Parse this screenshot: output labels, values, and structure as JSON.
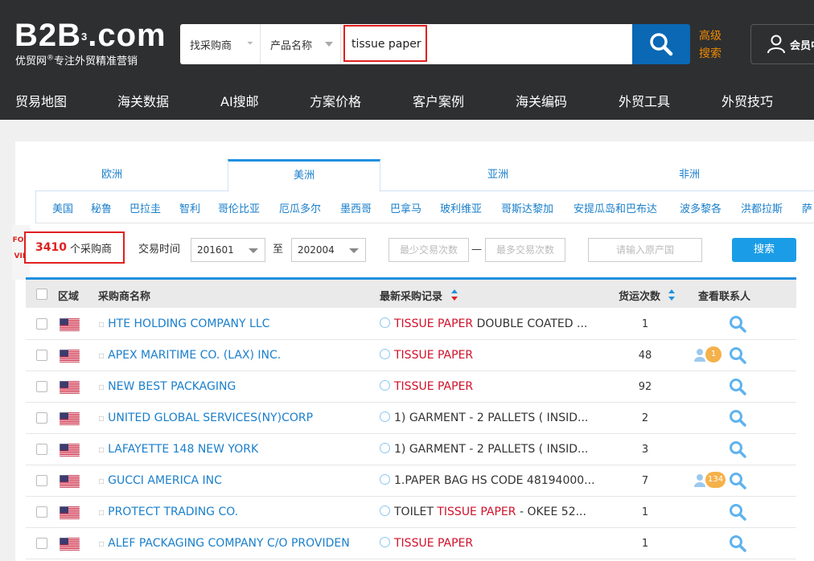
{
  "header": {
    "logo": "B2B",
    "logo_sup": "3",
    "logo_suffix": ".com",
    "tagline": "优贸网",
    "tagline_reg": "®",
    "tagline_rest": "专注外贸精准营销",
    "search": {
      "type_select": "找采购商",
      "field_select": "产品名称",
      "query": "tissue paper"
    },
    "advanced_line1": "高级",
    "advanced_line2": "搜索",
    "member_label": "会员中"
  },
  "nav": [
    "贸易地图",
    "海关数据",
    "AI搜邮",
    "方案价格",
    "客户案例",
    "海关编码",
    "外贸工具",
    "外贸技巧"
  ],
  "region_tabs": [
    "欧洲",
    "美洲",
    "亚洲",
    "非洲"
  ],
  "active_region": "美洲",
  "countries": [
    "美国",
    "秘鲁",
    "巴拉圭",
    "智利",
    "哥伦比亚",
    "厄瓜多尔",
    "墨西哥",
    "巴拿马",
    "玻利维亚",
    "哥斯达黎加",
    "安提瓜岛和巴布达",
    "波多黎各",
    "洪都拉斯",
    "萨"
  ],
  "filters": {
    "vip_line1": "FOR",
    "vip_line2": "VIP",
    "count": "3410",
    "count_unit": "个采购商",
    "time_label": "交易时间",
    "from": "201601",
    "to_label": "至",
    "to": "202004",
    "min_placeholder": "最少交易次数",
    "dash": "—",
    "max_placeholder": "最多交易次数",
    "origin_placeholder": "请输入原产国",
    "search_button": "搜索"
  },
  "table": {
    "columns": [
      "区域",
      "采购商名称",
      "最新采购记录",
      "货运次数",
      "查看联系人"
    ],
    "rows": [
      {
        "name": "HTE HOLDING COMPANY LLC",
        "rec_pre": "",
        "rec_hl": "TISSUE PAPER",
        "rec_post": " DOUBLE COATED ...",
        "shipments": "1",
        "contacts": ""
      },
      {
        "name": "APEX MARITIME CO. (LAX) INC.",
        "rec_pre": "",
        "rec_hl": "TISSUE PAPER",
        "rec_post": "",
        "shipments": "48",
        "contacts": "1"
      },
      {
        "name": "NEW BEST PACKAGING",
        "rec_pre": "",
        "rec_hl": "TISSUE PAPER",
        "rec_post": "",
        "shipments": "92",
        "contacts": ""
      },
      {
        "name": "UNITED GLOBAL SERVICES(NY)CORP",
        "rec_pre": "1) GARMENT - 2 PALLETS ( INSID...",
        "rec_hl": "",
        "rec_post": "",
        "shipments": "2",
        "contacts": ""
      },
      {
        "name": "LAFAYETTE 148 NEW YORK",
        "rec_pre": "1) GARMENT - 2 PALLETS ( INSID...",
        "rec_hl": "",
        "rec_post": "",
        "shipments": "3",
        "contacts": ""
      },
      {
        "name": "GUCCI AMERICA INC",
        "rec_pre": "1.PAPER BAG HS CODE 48194000...",
        "rec_hl": "",
        "rec_post": "",
        "shipments": "7",
        "contacts": "134"
      },
      {
        "name": "PROTECT TRADING CO.",
        "rec_pre": "TOILET ",
        "rec_hl": "TISSUE PAPER",
        "rec_post": " - OKEE 52...",
        "shipments": "1",
        "contacts": ""
      },
      {
        "name": "ALEF PACKAGING COMPANY C/O PROVIDEN",
        "rec_pre": "",
        "rec_hl": "TISSUE PAPER",
        "rec_post": "",
        "shipments": "1",
        "contacts": ""
      }
    ]
  }
}
